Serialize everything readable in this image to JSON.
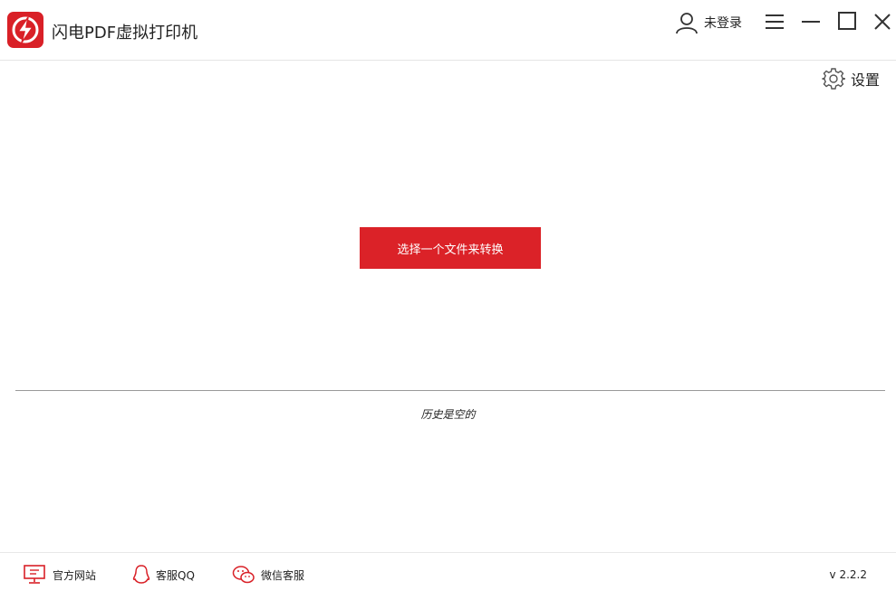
{
  "app": {
    "title": "闪电PDF虚拟打印机",
    "brand_color": "#d92027",
    "logo_icon": "lightning-bolt-icon"
  },
  "header": {
    "user_label": "未登录",
    "menu_icon": "hamburger-menu-icon",
    "minimize_icon": "minimize-icon",
    "maximize_icon": "maximize-icon",
    "close_icon": "close-icon"
  },
  "settings": {
    "label": "设置",
    "icon": "gear-icon"
  },
  "main": {
    "convert_button_label": "选择一个文件来转换",
    "history_empty_text": "历史是空的"
  },
  "footer": {
    "links": [
      {
        "label": "官方网站",
        "icon": "monitor-icon"
      },
      {
        "label": "客服QQ",
        "icon": "qq-penguin-icon"
      },
      {
        "label": "微信客服",
        "icon": "wechat-icon"
      }
    ],
    "version": "v 2.2.2"
  }
}
